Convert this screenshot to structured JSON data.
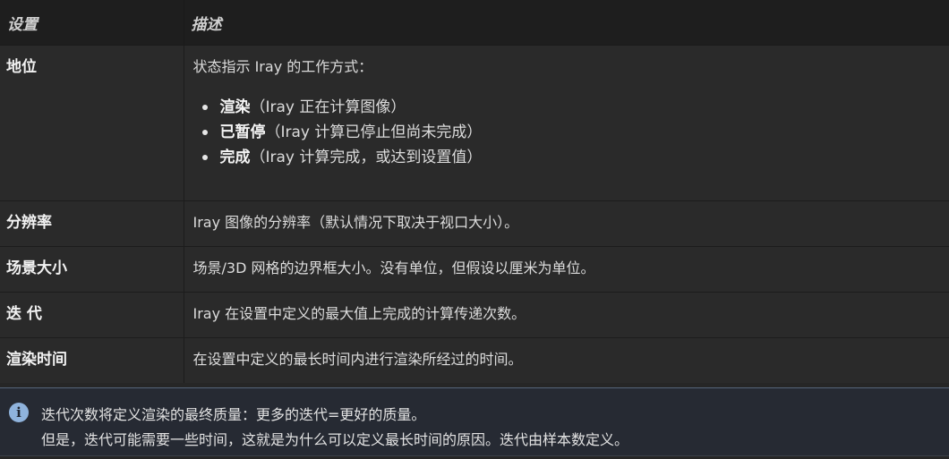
{
  "table": {
    "headers": {
      "setting": "设置",
      "description": "描述"
    },
    "rows": {
      "status": {
        "name": "地位",
        "intro": "状态指示 Iray 的工作方式：",
        "states": [
          {
            "term": "渲染",
            "detail": "（Iray 正在计算图像）"
          },
          {
            "term": "已暂停",
            "detail": "（Iray 计算已停止但尚未完成）"
          },
          {
            "term": "完成",
            "detail": "（Iray 计算完成，或达到设置值）"
          }
        ]
      },
      "resolution": {
        "name": "分辨率",
        "desc": "Iray 图像的分辨率（默认情况下取决于视口大小）。"
      },
      "scene_size": {
        "name": "场景大小",
        "desc": "场景/3D 网格的边界框大小。没有单位，但假设以厘米为单位。"
      },
      "iterations": {
        "name": "迭 代",
        "desc": "Iray 在设置中定义的最大值上完成的计算传递次数。"
      },
      "render_time": {
        "name": "渲染时间",
        "desc": "在设置中定义的最长时间内进行渲染所经过的时间。"
      }
    }
  },
  "note": {
    "icon": "info-icon",
    "icon_glyph": "i",
    "line1": "迭代次数将定义渲染的最终质量：更多的迭代=更好的质量。",
    "line2": "但是，迭代可能需要一些时间，这就是为什么可以定义最长时间的原因。迭代由样本数定义。"
  }
}
